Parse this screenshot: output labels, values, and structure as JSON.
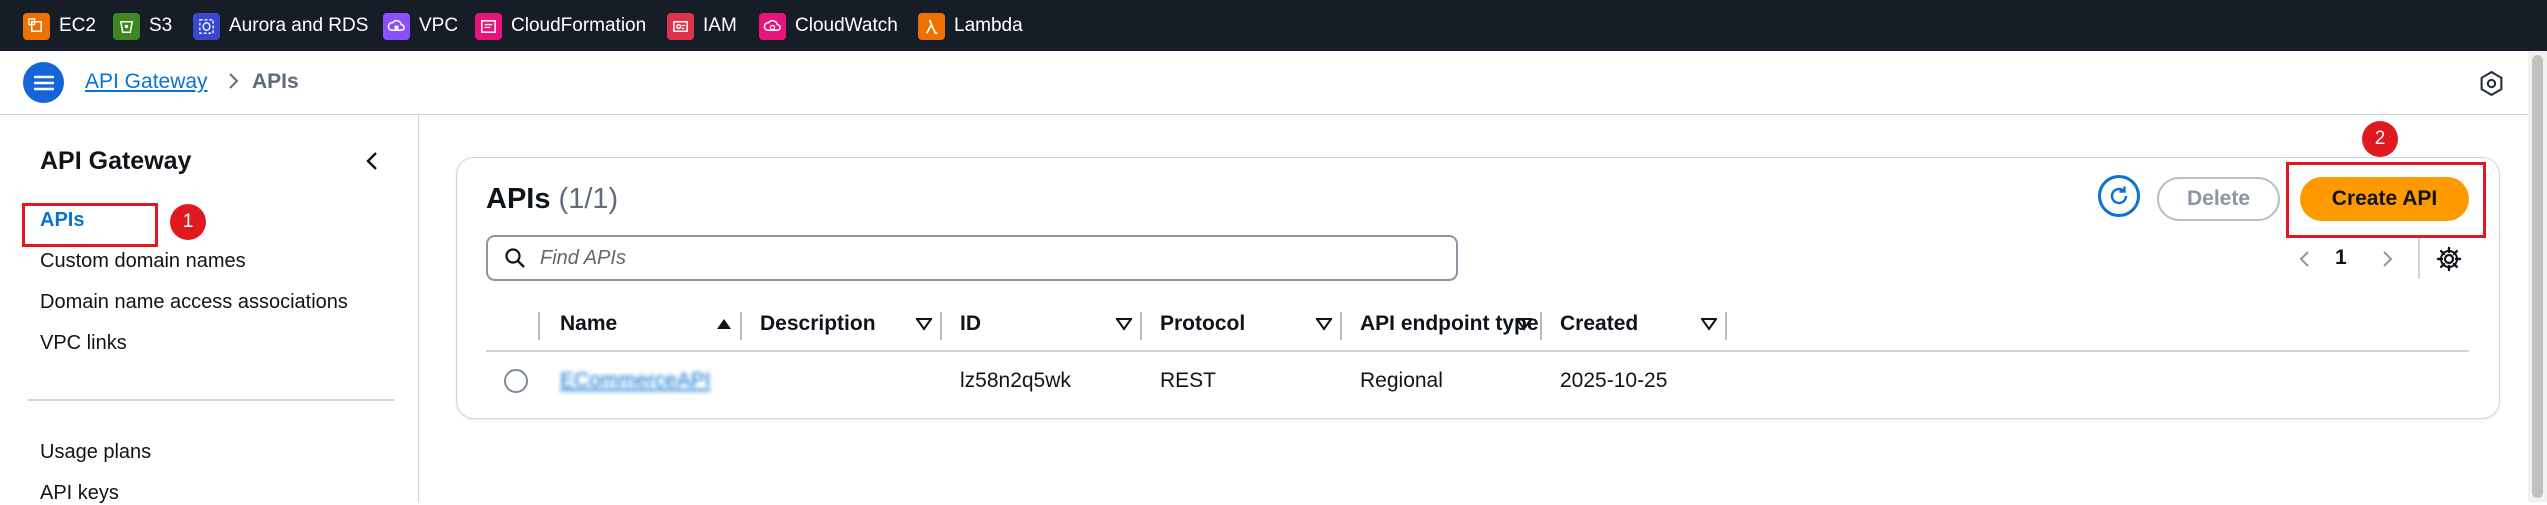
{
  "service_bar": {
    "items": [
      {
        "label": "EC2",
        "icon": "ec2-icon",
        "color": "#ed7100"
      },
      {
        "label": "S3",
        "icon": "s3-icon",
        "color": "#3f8624"
      },
      {
        "label": "Aurora and RDS",
        "icon": "rds-icon",
        "color": "#3b48cc"
      },
      {
        "label": "VPC",
        "icon": "vpc-icon",
        "color": "#8c4fff"
      },
      {
        "label": "CloudFormation",
        "icon": "cloudformation-icon",
        "color": "#e7157b"
      },
      {
        "label": "IAM",
        "icon": "iam-icon",
        "color": "#dd344c"
      },
      {
        "label": "CloudWatch",
        "icon": "cloudwatch-icon",
        "color": "#e7157b"
      },
      {
        "label": "Lambda",
        "icon": "lambda-icon",
        "color": "#ed7100"
      }
    ]
  },
  "breadcrumb": {
    "root": "API Gateway",
    "current": "APIs"
  },
  "sidebar": {
    "title": "API Gateway",
    "items": [
      {
        "label": "APIs",
        "active": true
      },
      {
        "label": "Custom domain names"
      },
      {
        "label": "Domain name access associations"
      },
      {
        "label": "VPC links"
      },
      {
        "label": "Usage plans"
      },
      {
        "label": "API keys"
      }
    ]
  },
  "annotations": [
    "1",
    "2"
  ],
  "main": {
    "title": "APIs",
    "count": "(1/1)",
    "delete_label": "Delete",
    "create_label": "Create API",
    "search_placeholder": "Find APIs",
    "page": "1",
    "columns": [
      "Name",
      "Description",
      "ID",
      "Protocol",
      "API endpoint type",
      "Created"
    ],
    "rows": [
      {
        "name": "ECommerceAPI",
        "description": "",
        "id": "lz58n2q5wk",
        "protocol": "REST",
        "endpoint_type": "Regional",
        "created": "2025-10-25"
      }
    ]
  },
  "colors": {
    "accent": "#0972d3",
    "primary_button": "#ff9900",
    "service_bar_bg": "#161d26",
    "annotation": "#e0191e"
  }
}
